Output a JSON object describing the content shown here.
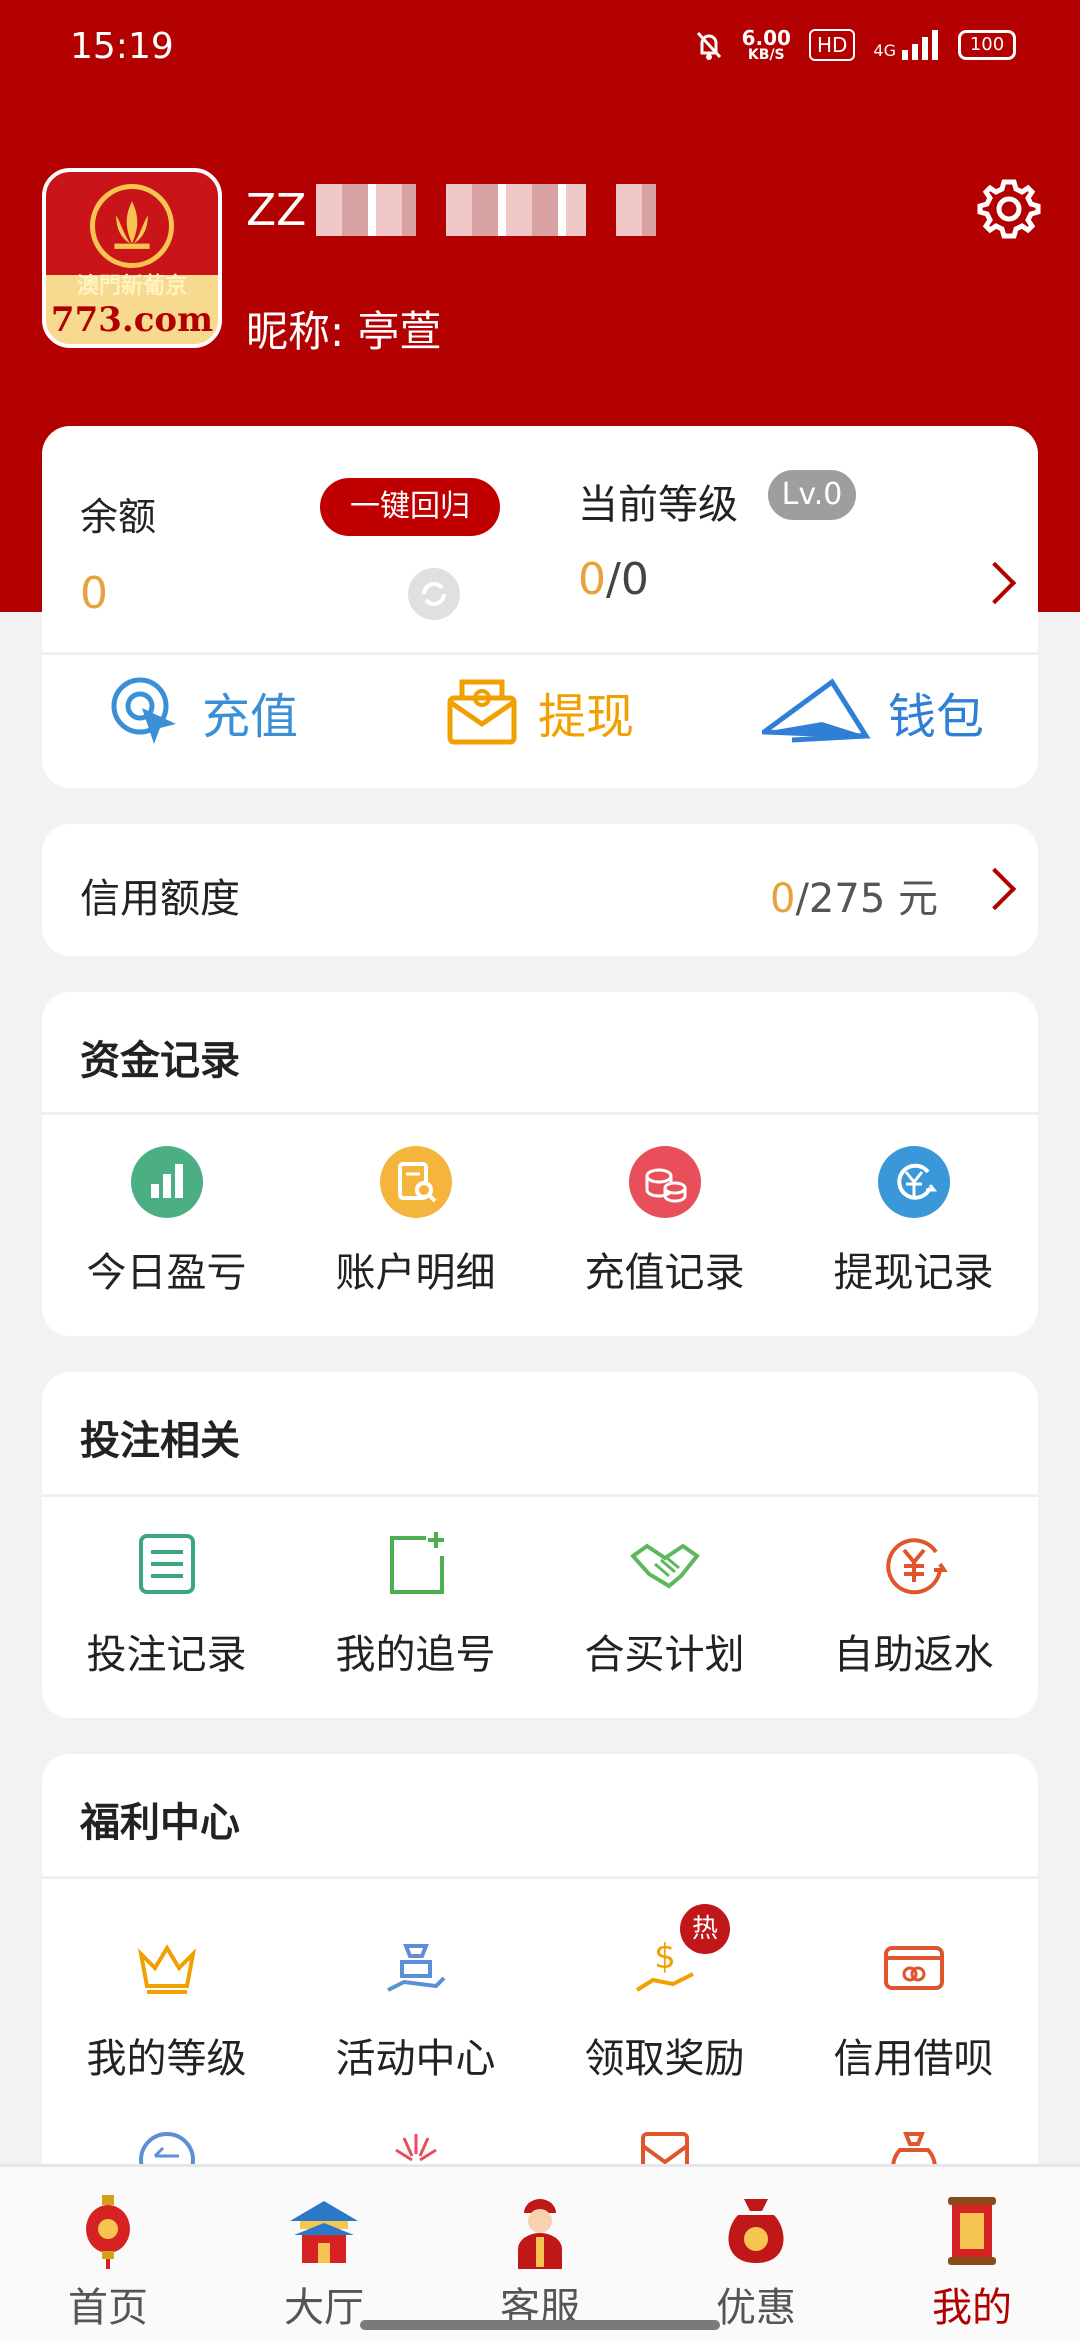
{
  "status_bar": {
    "time": "15:19",
    "speed": "6.00",
    "speed_unit": "KB/S",
    "hd": "HD",
    "network": "4G",
    "battery": "100"
  },
  "profile": {
    "logo_line1": "澳門新葡京",
    "logo_line2": "773.com",
    "username": "ZZ",
    "nickname": "昵称: 亭萱"
  },
  "balance": {
    "label": "余额",
    "one_key_label": "一键回归",
    "value": "0",
    "level_label": "当前等级",
    "level_badge": "Lv.0",
    "level_current": "0",
    "level_total": "/0"
  },
  "actions": [
    {
      "label": "充值",
      "icon": "recharge-icon",
      "color": "#3b8fd6"
    },
    {
      "label": "提现",
      "icon": "withdraw-icon",
      "color": "#f0a000"
    },
    {
      "label": "钱包",
      "icon": "wallet-icon",
      "color": "#2f7fd6"
    }
  ],
  "credit": {
    "label": "信用额度",
    "current": "0",
    "total": "/275 元"
  },
  "fund_records": {
    "title": "资金记录",
    "items": [
      {
        "label": "今日盈亏",
        "icon": "chart-icon",
        "color": "#4caf83"
      },
      {
        "label": "账户明细",
        "icon": "account-detail-icon",
        "color": "#f5b53d"
      },
      {
        "label": "充值记录",
        "icon": "coins-icon",
        "color": "#e84f5b"
      },
      {
        "label": "提现记录",
        "icon": "yuan-transfer-icon",
        "color": "#3a97d8"
      }
    ]
  },
  "bet_related": {
    "title": "投注相关",
    "items": [
      {
        "label": "投注记录",
        "icon": "list-icon",
        "color": "#3aa87a"
      },
      {
        "label": "我的追号",
        "icon": "add-note-icon",
        "color": "#4caf50"
      },
      {
        "label": "合买计划",
        "icon": "handshake-icon",
        "color": "#5cb85c"
      },
      {
        "label": "自助返水",
        "icon": "yuan-refund-icon",
        "color": "#e0552b"
      }
    ]
  },
  "welfare": {
    "title": "福利中心",
    "hot_badge": "热",
    "items": [
      {
        "label": "我的等级",
        "icon": "crown-icon",
        "color": "#f0a000"
      },
      {
        "label": "活动中心",
        "icon": "gift-hand-icon",
        "color": "#5b8fd6"
      },
      {
        "label": "领取奖励",
        "icon": "dollar-hand-icon",
        "color": "#f0a000"
      },
      {
        "label": "信用借呗",
        "icon": "card-icon",
        "color": "#e0552b"
      }
    ]
  },
  "tabbar": [
    {
      "label": "首页",
      "icon": "lantern-icon",
      "active": false
    },
    {
      "label": "大厅",
      "icon": "pavilion-icon",
      "active": false
    },
    {
      "label": "客服",
      "icon": "service-person-icon",
      "active": false
    },
    {
      "label": "优惠",
      "icon": "money-bag-icon",
      "active": false
    },
    {
      "label": "我的",
      "icon": "scroll-icon",
      "active": true
    }
  ]
}
